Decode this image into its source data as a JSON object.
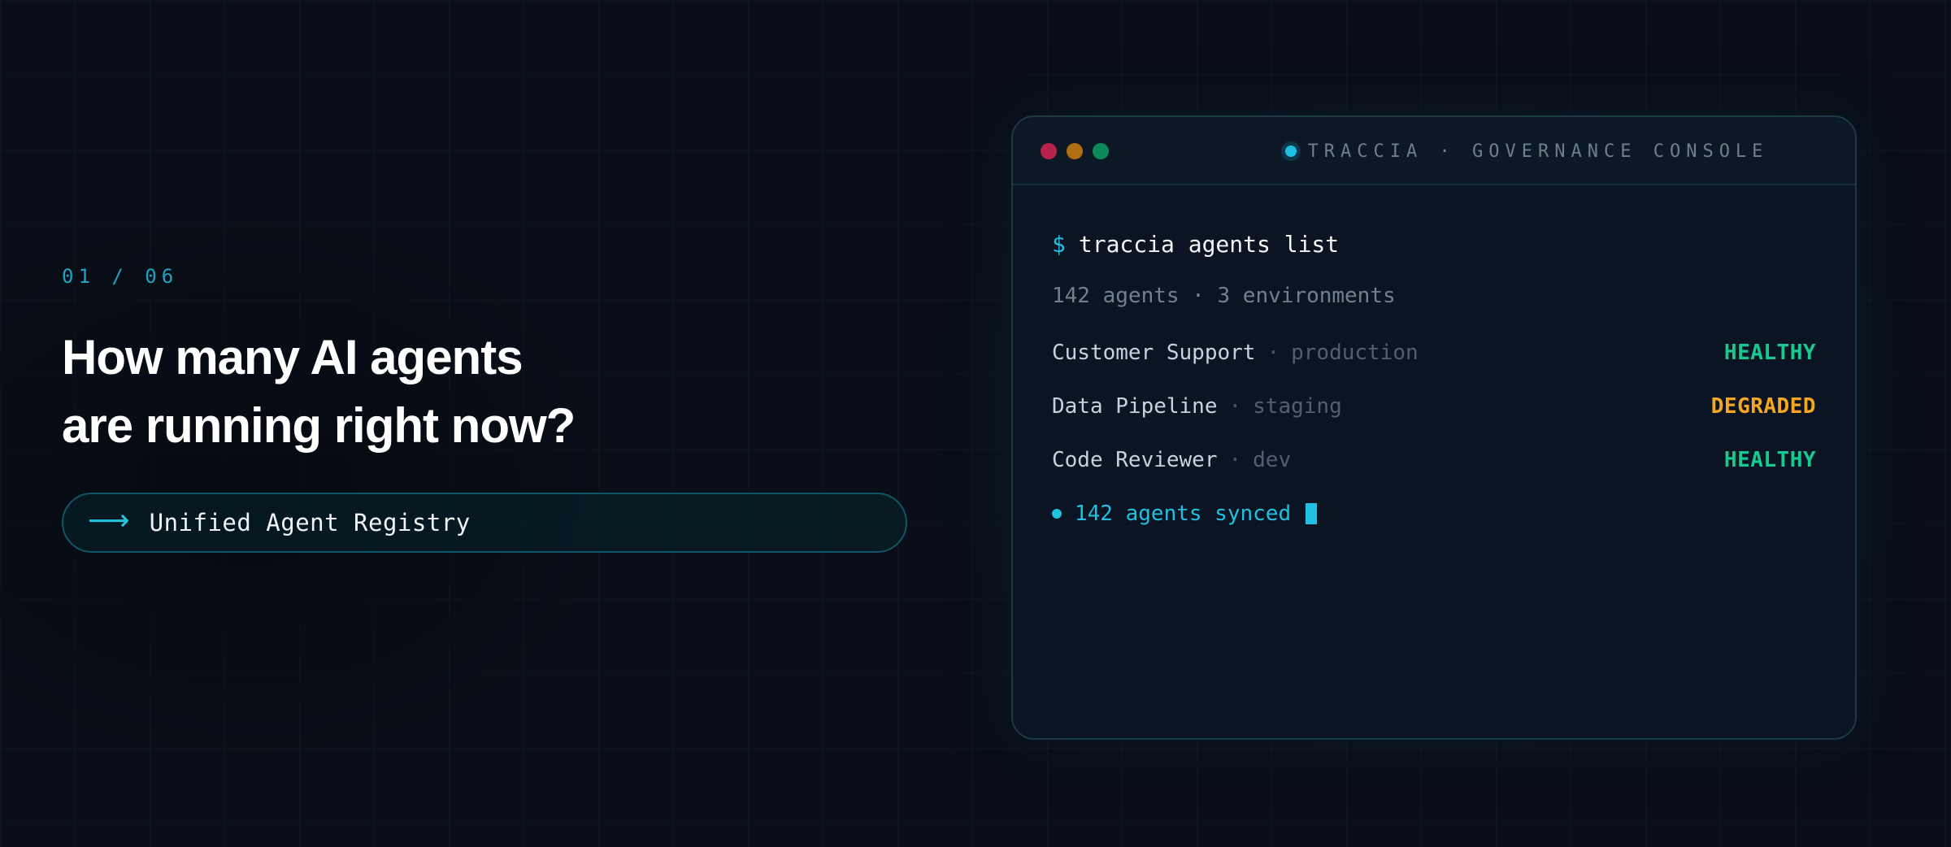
{
  "slide": {
    "counter": "01 / 06",
    "headline_line1": "How many AI agents",
    "headline_line2": "are running right now?",
    "pill_label": "Unified Agent Registry",
    "pill_icon": "arrow-right-icon"
  },
  "console": {
    "title": "TRACCIA · GOVERNANCE CONSOLE",
    "window_controls": [
      "close",
      "minimize",
      "maximize"
    ],
    "prompt": "$",
    "command": "traccia agents list",
    "summary": "142 agents · 3 environments",
    "agents": [
      {
        "name": "Customer Support",
        "separator": "·",
        "env": "production",
        "status": "HEALTHY"
      },
      {
        "name": "Data Pipeline",
        "separator": "·",
        "env": "staging",
        "status": "DEGRADED"
      },
      {
        "name": "Code Reviewer",
        "separator": "·",
        "env": "dev",
        "status": "HEALTHY"
      }
    ],
    "sync_text": "142 agents synced"
  },
  "colors": {
    "accent": "#1fc0e0",
    "healthy": "#18c98f",
    "degraded": "#f5a623",
    "close_dot": "#b8234a",
    "minimize_dot": "#b06d12",
    "maximize_dot": "#0d8a5c"
  }
}
